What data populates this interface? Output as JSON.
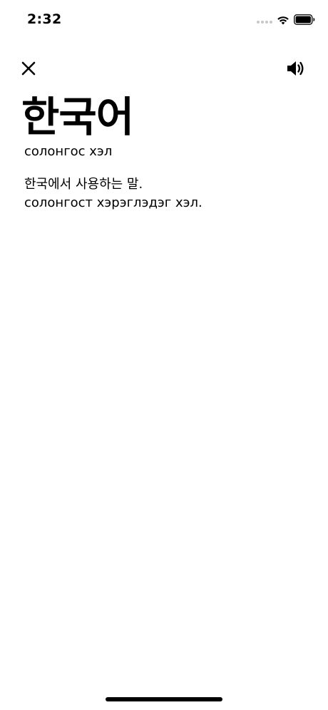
{
  "status_bar": {
    "time": "2:32",
    "icons": [
      "signal-dots-icon",
      "wifi-icon",
      "battery-icon"
    ]
  },
  "toolbar": {
    "close_icon": "close-icon",
    "speaker_icon": "speaker-icon"
  },
  "entry": {
    "headword": "한국어",
    "translation": "солонгос хэл",
    "definition_ko": "한국에서 사용하는 말.",
    "definition_mn": "солонгост хэрэглэдэг хэл."
  },
  "colors": {
    "background": "#ffffff",
    "text": "#000000",
    "signal_inactive": "#c7c7c7"
  }
}
